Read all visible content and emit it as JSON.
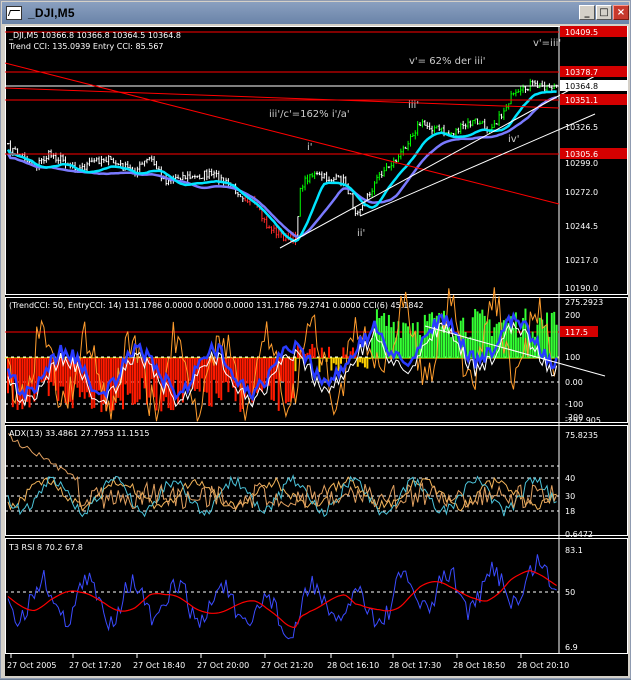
{
  "window": {
    "title": "_DJI,M5",
    "btn_min": "_",
    "btn_max": "□",
    "btn_close": "×"
  },
  "colors": {
    "bg": "#000000",
    "grid": "#ffffff",
    "price_up": "#00ff00",
    "price_down": "#ffffff",
    "ma_cyan": "#00e5ff",
    "ma_blue": "#7a7aff",
    "red_line": "#ff0000",
    "label_red": "#d40000",
    "cci_orange": "#ff9d2e",
    "adx_cyan": "#4cc3d9"
  },
  "main": {
    "header": "_DJI,M5  10366.8 10366.8 10364.5 10364.8",
    "subheader": "Trend CCI: 135.0939 Entry CCI: 85.567",
    "price_labels": [
      {
        "text": "10409.5",
        "color": "#ff0000"
      },
      {
        "text": "10378.7",
        "color": "#ff0000"
      },
      {
        "text": "10364.8",
        "color": "#ffffff"
      },
      {
        "text": "10351.1",
        "color": "#ff0000"
      },
      {
        "text": "10326.5",
        "color": "#000000"
      },
      {
        "text": "10305.6",
        "color": "#ff0000"
      },
      {
        "text": "10299.0",
        "color": "#000000"
      },
      {
        "text": "10272.0",
        "color": "#000000"
      },
      {
        "text": "10244.5",
        "color": "#000000"
      },
      {
        "text": "10217.0",
        "color": "#000000"
      },
      {
        "text": "10190.0",
        "color": "#000000"
      }
    ],
    "annotations": [
      "v'=iii'",
      "v'= 62% der iii'",
      "iii'",
      "iii'/c'=162% i'/a'",
      "i'",
      "ii'",
      "iv'"
    ]
  },
  "cci": {
    "header": "(TrendCCI: 50, EntryCCI: 14)  131.1786 0.0000 0.0000 0.0000 131.1786 79.2741 0.0000  CCI(6) 45.1842",
    "labels": [
      "275.2923",
      "200",
      "117.5",
      "100",
      "0.00",
      "-100",
      "-200",
      "-292.905"
    ]
  },
  "adx": {
    "header": "ADX(13) 33.4861 27.7953 11.1515",
    "labels": [
      "75.8235",
      "40",
      "30",
      "18",
      "0.6472"
    ]
  },
  "rsi": {
    "header": "T3 RSI 8 70.2 67.8",
    "labels": [
      "83.1",
      "50",
      "6.9"
    ]
  },
  "xaxis": [
    "27 Oct 2005",
    "27 Oct 17:20",
    "27 Oct 18:40",
    "27 Oct 20:00",
    "27 Oct 21:20",
    "28 Oct 16:10",
    "28 Oct 17:30",
    "28 Oct 18:50",
    "28 Oct 20:10"
  ]
}
